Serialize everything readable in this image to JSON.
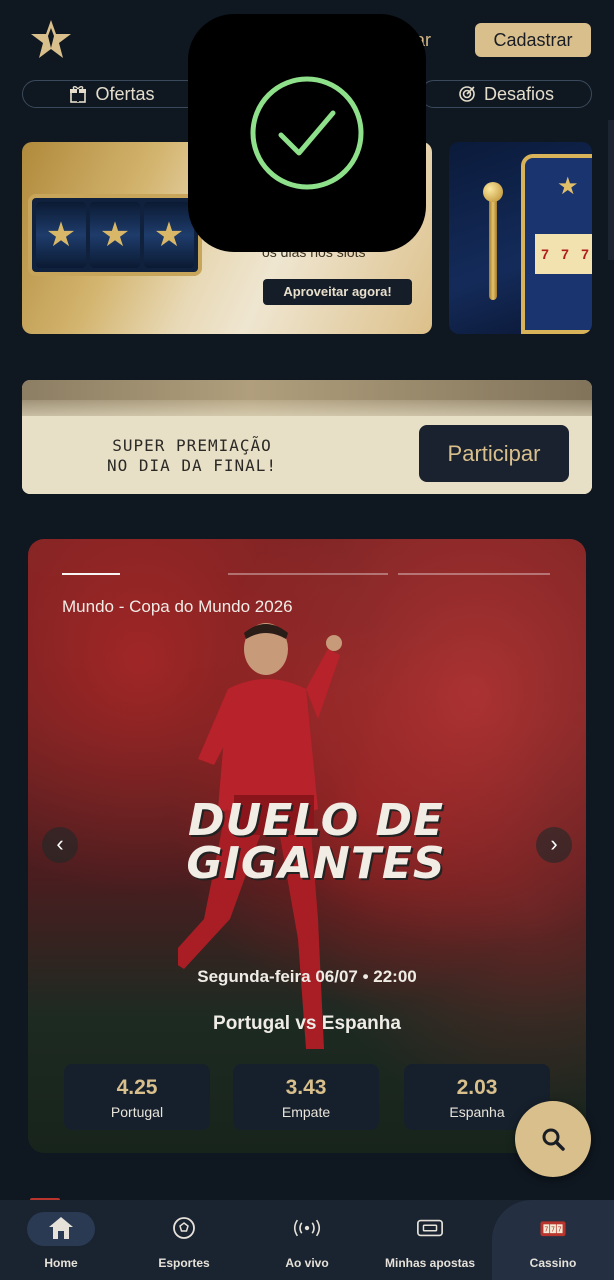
{
  "header": {
    "login_label": "trar",
    "signup_label": "Cadastrar",
    "pills": {
      "offers": "Ofertas",
      "challenges": "Desafios"
    }
  },
  "promo": {
    "desc": "os dias nos slots",
    "cta": "Aproveitar agora!"
  },
  "premio": {
    "line1": "SUPER PREMIAÇÃO",
    "line2": "NO DIA DA FINAL!",
    "button": "Participar"
  },
  "hero": {
    "league": "Mundo - Copa do Mundo 2026",
    "title_line1": "DUELO DE",
    "title_line2": "GIGANTES",
    "date": "Segunda-feira 06/07 • 22:00",
    "match": "Portugal vs Espanha",
    "odds": [
      {
        "value": "4.25",
        "label": "Portugal"
      },
      {
        "value": "3.43",
        "label": "Empate"
      },
      {
        "value": "2.03",
        "label": "Espanha"
      }
    ]
  },
  "bottom_nav": [
    {
      "label": "Home",
      "icon": "home-icon"
    },
    {
      "label": "Esportes",
      "icon": "soccer-ball-icon"
    },
    {
      "label": "Ao vivo",
      "icon": "live-broadcast-icon"
    },
    {
      "label": "Minhas apostas",
      "icon": "ticket-icon"
    },
    {
      "label": "Cassino",
      "icon": "slot-machine-icon"
    }
  ],
  "colors": {
    "background": "#0f1720",
    "accent_gold": "#d9bf8c",
    "card_dark": "#16202c",
    "success_green": "#8ee08a"
  }
}
